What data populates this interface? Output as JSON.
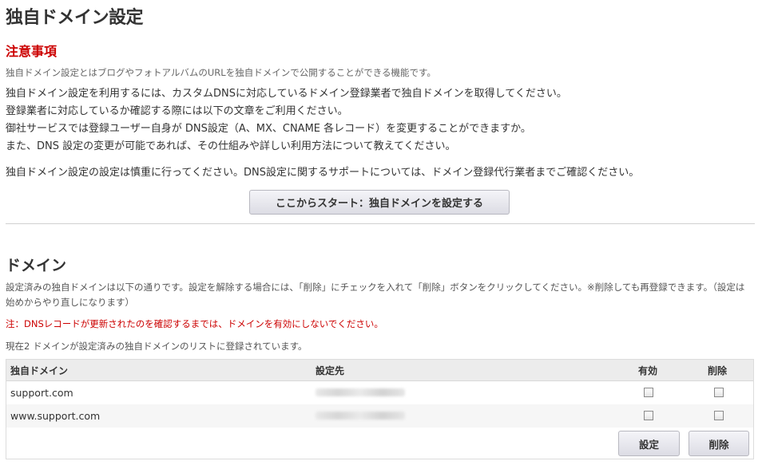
{
  "page": {
    "title": "独自ドメイン設定"
  },
  "notice": {
    "heading": "注意事項",
    "intro": "独自ドメイン設定とはブログやフォトアルバムのURLを独自ドメインで公開することができる機能です。",
    "lines": [
      "独自ドメイン設定を利用するには、カスタムDNSに対応しているドメイン登録業者で独自ドメインを取得してください。",
      "登録業者に対応しているか確認する際には以下の文章をご利用ください。",
      "御社サービスでは登録ユーザー自身が DNS設定（A、MX、CNAME 各レコード）を変更することができますか。",
      "また、DNS 設定の変更が可能であれば、その仕組みや詳しい利用方法について教えてください。"
    ],
    "caution": "独自ドメイン設定の設定は慎重に行ってください。DNS設定に関するサポートについては、ドメイン登録代行業者までご確認ください。",
    "start_button": "ここからスタート：独自ドメインを設定する"
  },
  "domains": {
    "heading": "ドメイン",
    "description": "設定済みの独自ドメインは以下の通りです。設定を解除する場合には、「削除」にチェックを入れて「削除」ボタンをクリックしてください。※削除しても再登録できます。（設定は始めからやり直しになります）",
    "warning": "注：DNSレコードが更新されたのを確認するまでは、ドメインを有効にしないでください。",
    "count_text": "現在2 ドメインが設定済みの独自ドメインのリストに登録されています。",
    "columns": {
      "domain": "独自ドメイン",
      "target": "設定先",
      "enabled": "有効",
      "delete": "削除"
    },
    "rows": [
      {
        "domain": "support.com"
      },
      {
        "domain": "www.support.com"
      }
    ],
    "save_button": "設定",
    "delete_button": "削除"
  }
}
